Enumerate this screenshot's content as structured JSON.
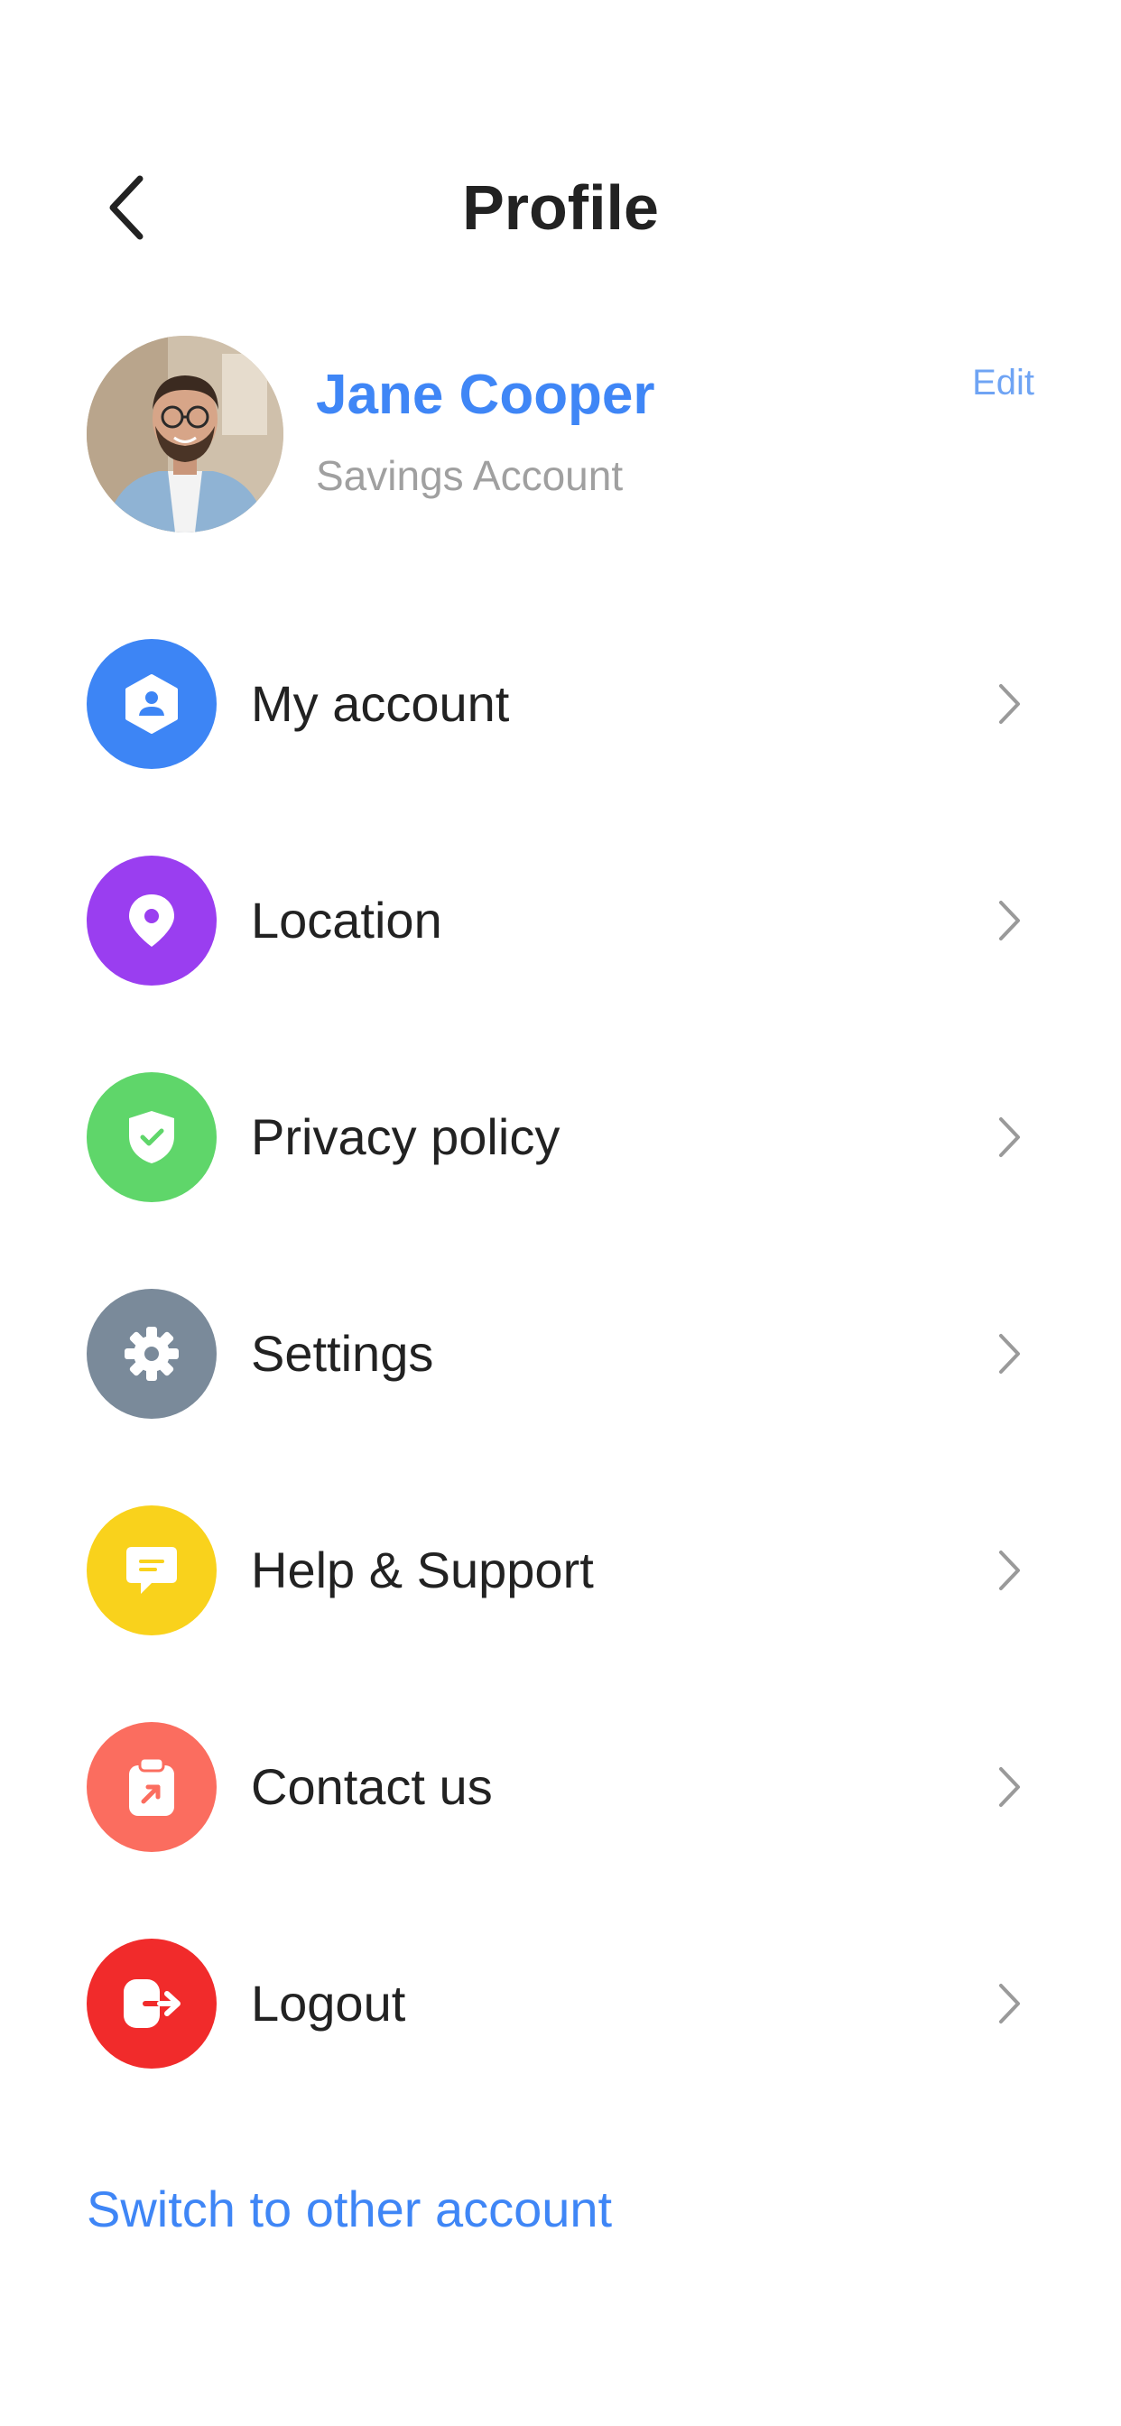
{
  "header": {
    "title": "Profile",
    "back_icon": "chevron-left-icon"
  },
  "profile": {
    "name": "Jane Cooper",
    "account_type": "Savings Account",
    "edit_label": "Edit",
    "avatar_icon": "avatar-photo"
  },
  "menu": {
    "items": [
      {
        "label": "My account",
        "icon": "user-hexagon-icon",
        "color": "#3d85f5"
      },
      {
        "label": "Location",
        "icon": "location-pin-icon",
        "color": "#9a3ef0"
      },
      {
        "label": "Privacy policy",
        "icon": "shield-check-icon",
        "color": "#5fd66a"
      },
      {
        "label": "Settings",
        "icon": "gear-icon",
        "color": "#7a8a9a"
      },
      {
        "label": "Help & Support",
        "icon": "chat-bubble-icon",
        "color": "#f9d21c"
      },
      {
        "label": "Contact us",
        "icon": "clipboard-arrow-icon",
        "color": "#fb6d5f"
      },
      {
        "label": "Logout",
        "icon": "logout-icon",
        "color": "#f12b2b"
      }
    ]
  },
  "footer": {
    "switch_label": "Switch to other account"
  },
  "colors": {
    "accent": "#3f86f6",
    "text": "#222222",
    "muted": "#a0a0a0",
    "chevron": "#9a9a9a"
  }
}
